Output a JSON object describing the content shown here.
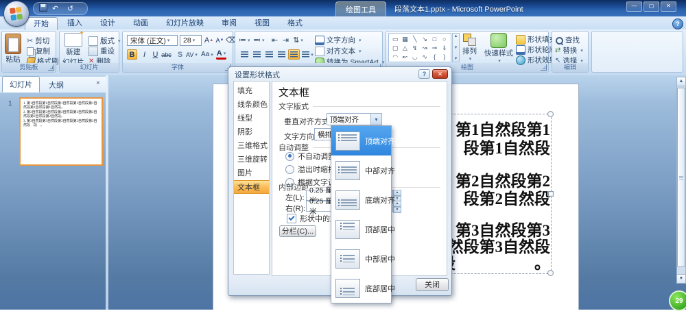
{
  "window": {
    "title": "段落文本1.pptx - Microsoft PowerPoint",
    "tools_label": "绘图工具",
    "minimize": "—",
    "maximize": "▢",
    "close": "✕",
    "help": "?"
  },
  "tabs": {
    "items": [
      {
        "label": "开始",
        "cls": "active"
      },
      {
        "label": "插入"
      },
      {
        "label": "设计"
      },
      {
        "label": "动画"
      },
      {
        "label": "幻灯片放映"
      },
      {
        "label": "审阅"
      },
      {
        "label": "视图"
      },
      {
        "label": "格式"
      }
    ]
  },
  "ribbon": {
    "clipboard": {
      "group": "剪贴板",
      "paste": "粘贴",
      "cut": "剪切",
      "copy": "复制",
      "painter": "格式刷"
    },
    "slides": {
      "group": "幻灯片",
      "new_slide_1": "新建",
      "new_slide_2": "幻灯片",
      "layout": "版式",
      "reset": "重设",
      "del": "删除"
    },
    "font": {
      "group": "字体",
      "name": "宋体 (正文)",
      "size": "28",
      "grow": "A",
      "shrink": "A",
      "bold": "B",
      "italic": "I",
      "underline": "U",
      "strike": "abc",
      "shadow": "S",
      "spacing": "AV",
      "case": "Aa",
      "color": "A"
    },
    "paragraph": {
      "text_direction": "文字方向",
      "align_text": "对齐文本",
      "smartart": "转换为 SmartArt"
    },
    "drawing": {
      "group": "绘图",
      "shapes": [
        "▭",
        "▦",
        "╲",
        "↘",
        "□",
        "○",
        "▢",
        "△",
        "↯",
        "↝",
        "⇒",
        "⇓",
        "◠",
        "↜",
        "◡",
        "∿",
        "{",
        "}"
      ],
      "arrange": "排列",
      "quick_styles": "快速样式",
      "fill": "形状填充",
      "outline": "形状轮廓",
      "effects": "形状效果"
    },
    "editing": {
      "group": "编辑",
      "find": "查找",
      "replace": "替换",
      "select": "选择"
    }
  },
  "sidebar": {
    "tab_slides": "幻灯片",
    "tab_outline": "大纲",
    "close": "×",
    "slide_number": "1",
    "thumb_lines": [
      "1. 第1自然段第1自然段第1自然段第1自然段第1自然段第1自然段第1自然段。",
      "2. 第2自然段第2自然段第2自然段第2自然段第2自然段第2自然段第2自然段。",
      "3. 第3自然段第3自然段第3自然段第3自然段第3自然段　段　。"
    ]
  },
  "slide": {
    "lines": [
      "第1自然段第1",
      "段第1自然段",
      "第2自然段第2",
      "段第2自然段",
      "第3自然段第3",
      "然段第3自然段",
      "段　　　　　。"
    ]
  },
  "dialog": {
    "title": "设置形状格式",
    "help": "?",
    "close_x": "✕",
    "menu": [
      {
        "label": "填充"
      },
      {
        "label": "线条颜色"
      },
      {
        "label": "线型"
      },
      {
        "label": "阴影"
      },
      {
        "label": "三维格式"
      },
      {
        "label": "三维旋转"
      },
      {
        "label": "图片"
      },
      {
        "label": "文本框",
        "cls": "sel"
      }
    ],
    "heading": "文本框",
    "section_text_layout": "文字版式",
    "valign_label": "垂直对齐方式(V):",
    "valign_value": "顶端对齐",
    "direction_label": "文字方向(X):",
    "direction_value": "横排",
    "section_autofit": "自动调整",
    "autofit_options": [
      {
        "label": "不自动调整(D)",
        "cls": "on"
      },
      {
        "label": "溢出时缩排文字"
      },
      {
        "label": "根据文字调整形"
      }
    ],
    "section_margin": "内部边距",
    "left_label": "左(L):",
    "left_value": "0.25 厘米",
    "right_label": "右(R):",
    "right_value": "0.25 厘米",
    "partial_unit_top": "米",
    "partial_unit_bottom": "米",
    "wrap_label": "形状中的文字自",
    "columns_button": "分栏(C)...",
    "close_button": "关闭"
  },
  "valign_dropdown": {
    "items": [
      {
        "label": "顶端对齐",
        "cls": "sel top"
      },
      {
        "label": "中部对齐",
        "cls": "mid"
      },
      {
        "label": "底端对齐",
        "cls": "bot"
      },
      {
        "label": "顶部居中",
        "cls": "top cen"
      },
      {
        "label": "中部居中",
        "cls": "mid cen"
      },
      {
        "label": "底部居中",
        "cls": "bot cen"
      }
    ]
  },
  "badge": {
    "text": "29"
  },
  "colors": {
    "titlebar_blue": "#1b4a93",
    "workspace_top": "#b9d3ec",
    "workspace_bottom": "#4d74a4",
    "selection_blue": "#3d95e8",
    "menu_selected_orange": "#f5a93c",
    "thumb_border_orange": "#e8973f",
    "dialog_close_red": "#d8573c",
    "badge_green": "#37a81f"
  }
}
